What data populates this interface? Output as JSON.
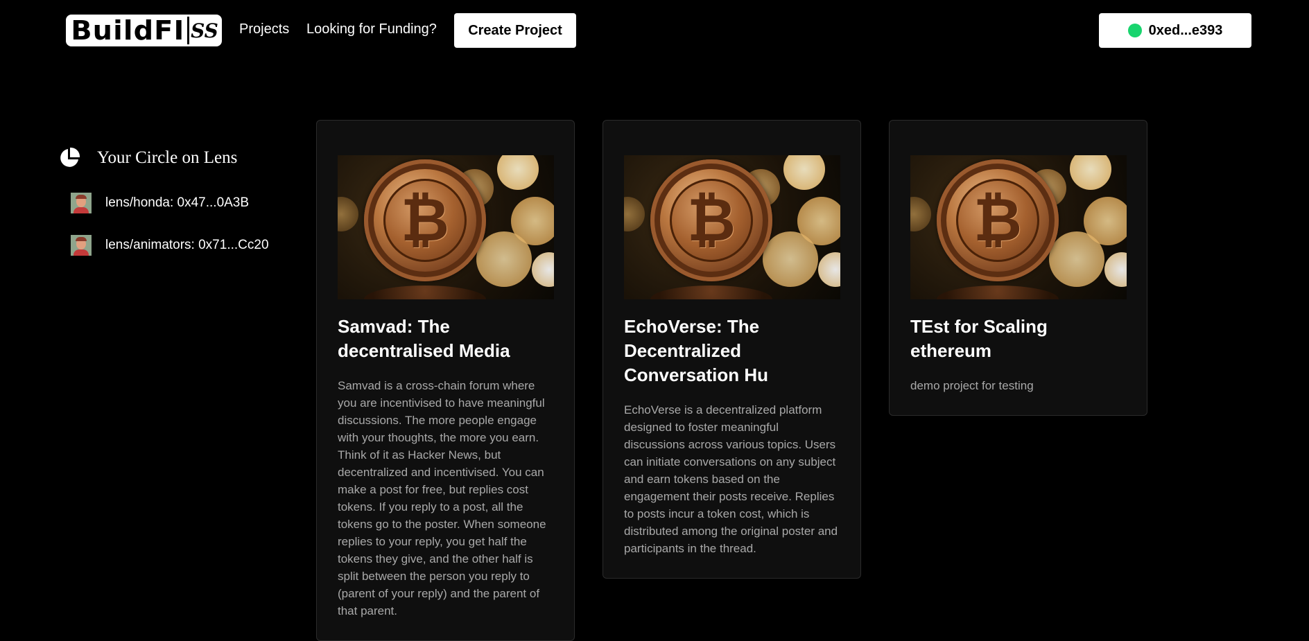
{
  "nav": {
    "logo_main": "BuildFI",
    "logo_suffix": "SS",
    "links": [
      "Projects",
      "Looking for Funding?"
    ],
    "create_label": "Create Project",
    "wallet_address": "0xed...e393",
    "wallet_status_color": "#19d46e"
  },
  "sidebar": {
    "title": "Your Circle on Lens",
    "title_icon": "pie-chart-icon",
    "items": [
      {
        "label": "lens/honda: 0x47...0A3B",
        "avatar": "avatar-icon"
      },
      {
        "label": "lens/animators: 0x71...Cc20",
        "avatar": "avatar-icon"
      }
    ]
  },
  "projects": [
    {
      "title": "Samvad: The decentralised Media",
      "image": "bitcoin-image",
      "description": "Samvad is a cross-chain forum where you are incentivised to have meaningful discussions. The more people engage with your thoughts, the more you earn. Think of it as Hacker News, but decentralized and incentivised. You can make a post for free, but replies cost tokens. If you reply to a post, all the tokens go to the poster. When someone replies to your reply, you get half the tokens they give, and the other half is split between the person you reply to (parent of your reply) and the parent of that parent."
    },
    {
      "title": "EchoVerse: The Decentralized Conversation Hu",
      "image": "bitcoin-image",
      "description": "EchoVerse is a decentralized platform designed to foster meaningful discussions across various topics. Users can initiate conversations on any subject and earn tokens based on the engagement their posts receive. Replies to posts incur a token cost, which is distributed among the original poster and participants in the thread."
    },
    {
      "title": "TEst for Scaling ethereum",
      "image": "bitcoin-image",
      "description": "demo project for testing"
    }
  ],
  "colors": {
    "background": "#000000",
    "card_background": "#0f0f0f",
    "description_text": "#a9a9a9"
  }
}
